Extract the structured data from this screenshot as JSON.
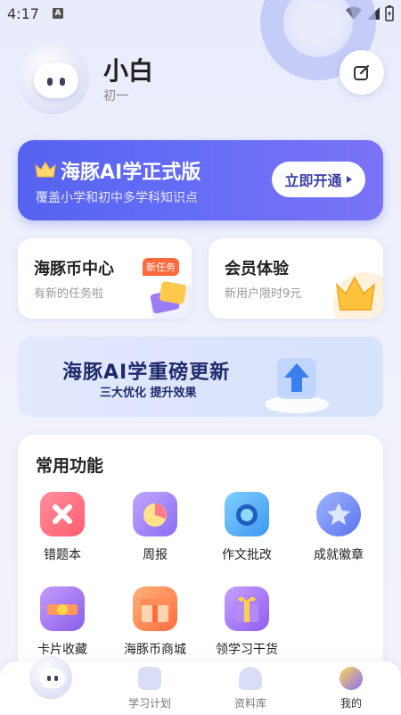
{
  "status_bar": {
    "time": "4:17",
    "notification_letter": "A"
  },
  "profile": {
    "name": "小白",
    "grade": "初一"
  },
  "vip_banner": {
    "title": "海豚AI学正式版",
    "subtitle": "覆盖小学和初中多学科知识点",
    "button_label": "立即开通"
  },
  "coin_card": {
    "title": "海豚币中心",
    "badge": "新任务",
    "subtitle": "有新的任务啦"
  },
  "member_card": {
    "title": "会员体验",
    "subtitle": "新用户限时9元"
  },
  "promo": {
    "title": "海豚AI学重磅更新",
    "subtitle": "三大优化 提升效果"
  },
  "functions": {
    "title": "常用功能",
    "items": [
      {
        "label": "错题本",
        "icon": "wrong-answers-icon",
        "color": "#ff6d7c"
      },
      {
        "label": "周报",
        "icon": "weekly-report-icon",
        "color": "#9a7cf6"
      },
      {
        "label": "作文批改",
        "icon": "camera-icon",
        "color": "#4fa7f5"
      },
      {
        "label": "成就徽章",
        "icon": "badge-icon",
        "color": "#6c8cf3"
      },
      {
        "label": "卡片收藏",
        "icon": "card-collection-icon",
        "color": "#9b6fe8"
      },
      {
        "label": "海豚币商城",
        "icon": "gift-shop-icon",
        "color": "#ff8a54"
      },
      {
        "label": "领学习干货",
        "icon": "gift-box-icon",
        "color": "#a56ff0"
      }
    ]
  },
  "bottom_nav": {
    "items": [
      {
        "label": "学习计划",
        "icon": "study-plan-icon"
      },
      {
        "label": "资料库",
        "icon": "library-icon"
      },
      {
        "label": "我的",
        "icon": "profile-icon"
      }
    ]
  },
  "colors": {
    "accent": "#5563f0",
    "badge_orange": "#ff6a3c",
    "background": "#eceffb"
  }
}
